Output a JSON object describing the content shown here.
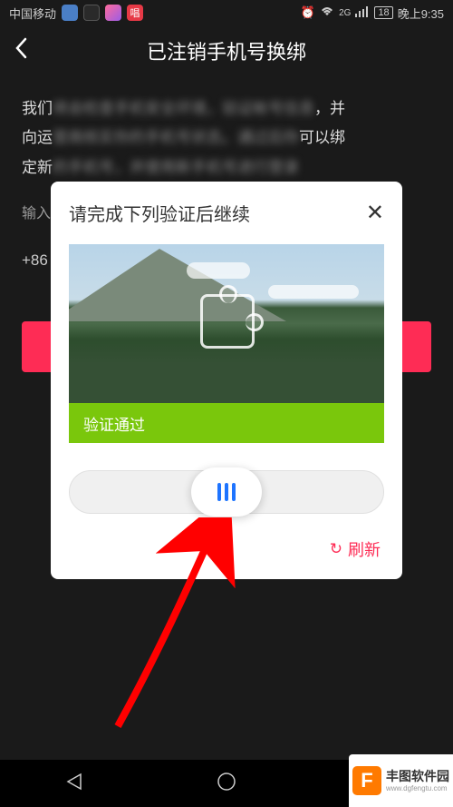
{
  "status_bar": {
    "carrier": "中国移动",
    "network": "2G",
    "battery": "18",
    "time": "晚上9:35",
    "chang_label": "唱"
  },
  "header": {
    "title": "已注销手机号换绑"
  },
  "content": {
    "line1_start": "我们",
    "line1_end": "，并",
    "line2_start": "向运",
    "line2_end": "可以绑",
    "line3_start": "定新",
    "input_label": "输入",
    "country_code": "+86"
  },
  "modal": {
    "title": "请完成下列验证后继续",
    "success_text": "验证通过",
    "refresh_label": "刷新"
  },
  "watermark": {
    "logo_letter": "F",
    "name": "丰图软件园",
    "url": "www.dgfengtu.com"
  }
}
